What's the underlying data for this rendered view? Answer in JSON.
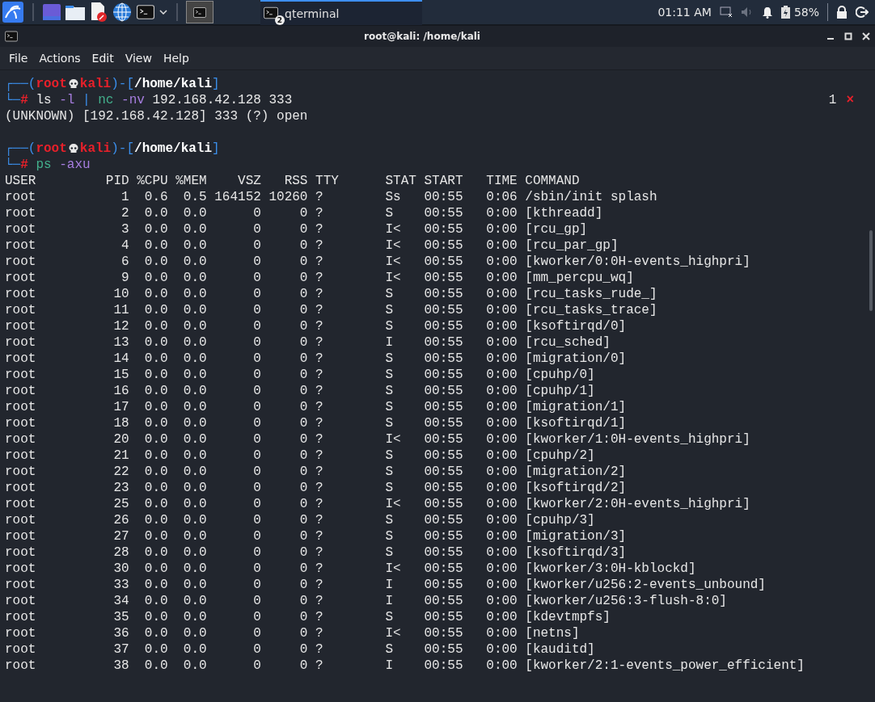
{
  "taskbar": {
    "task": {
      "label": "qterminal",
      "count": "2"
    },
    "clock": "01:11 AM",
    "battery": "58%"
  },
  "window": {
    "title": "root@kali: /home/kali"
  },
  "menu": [
    "File",
    "Actions",
    "Edit",
    "View",
    "Help"
  ],
  "terminal": {
    "blocks": [
      {
        "prompt": {
          "frame_open": "┌──(",
          "user": "root",
          "host": "kali",
          "frame_mid": ")-[",
          "path": "/home/kali",
          "frame_close": "]",
          "corner": "└─",
          "symbol": "#",
          "command": [
            {
              "text": "ls",
              "kind": "cmd"
            },
            {
              "text": " -l ",
              "kind": "opt"
            },
            {
              "text": "|",
              "kind": "pipe"
            },
            {
              "text": " nc",
              "kind": "prog"
            },
            {
              "text": " -nv",
              "kind": "opt"
            },
            {
              "text": " 192.168.42.128 333",
              "kind": "arg"
            }
          ]
        },
        "status": {
          "code": "1",
          "mark": "×"
        },
        "output": [
          "(UNKNOWN) [192.168.42.128] 333 (?) open"
        ]
      },
      {
        "prompt": {
          "frame_open": "┌──(",
          "user": "root",
          "host": "kali",
          "frame_mid": ")-[",
          "path": "/home/kali",
          "frame_close": "]",
          "corner": "└─",
          "symbol": "#",
          "command": [
            {
              "text": "ps",
              "kind": "prog"
            },
            {
              "text": " -axu",
              "kind": "opt"
            }
          ]
        },
        "output": [
          "USER         PID %CPU %MEM    VSZ   RSS TTY      STAT START   TIME COMMAND",
          "root           1  0.6  0.5 164152 10260 ?        Ss   00:55   0:06 /sbin/init splash",
          "root           2  0.0  0.0      0     0 ?        S    00:55   0:00 [kthreadd]",
          "root           3  0.0  0.0      0     0 ?        I<   00:55   0:00 [rcu_gp]",
          "root           4  0.0  0.0      0     0 ?        I<   00:55   0:00 [rcu_par_gp]",
          "root           6  0.0  0.0      0     0 ?        I<   00:55   0:00 [kworker/0:0H-events_highpri]",
          "root           9  0.0  0.0      0     0 ?        I<   00:55   0:00 [mm_percpu_wq]",
          "root          10  0.0  0.0      0     0 ?        S    00:55   0:00 [rcu_tasks_rude_]",
          "root          11  0.0  0.0      0     0 ?        S    00:55   0:00 [rcu_tasks_trace]",
          "root          12  0.0  0.0      0     0 ?        S    00:55   0:00 [ksoftirqd/0]",
          "root          13  0.0  0.0      0     0 ?        I    00:55   0:00 [rcu_sched]",
          "root          14  0.0  0.0      0     0 ?        S    00:55   0:00 [migration/0]",
          "root          15  0.0  0.0      0     0 ?        S    00:55   0:00 [cpuhp/0]",
          "root          16  0.0  0.0      0     0 ?        S    00:55   0:00 [cpuhp/1]",
          "root          17  0.0  0.0      0     0 ?        S    00:55   0:00 [migration/1]",
          "root          18  0.0  0.0      0     0 ?        S    00:55   0:00 [ksoftirqd/1]",
          "root          20  0.0  0.0      0     0 ?        I<   00:55   0:00 [kworker/1:0H-events_highpri]",
          "root          21  0.0  0.0      0     0 ?        S    00:55   0:00 [cpuhp/2]",
          "root          22  0.0  0.0      0     0 ?        S    00:55   0:00 [migration/2]",
          "root          23  0.0  0.0      0     0 ?        S    00:55   0:00 [ksoftirqd/2]",
          "root          25  0.0  0.0      0     0 ?        I<   00:55   0:00 [kworker/2:0H-events_highpri]",
          "root          26  0.0  0.0      0     0 ?        S    00:55   0:00 [cpuhp/3]",
          "root          27  0.0  0.0      0     0 ?        S    00:55   0:00 [migration/3]",
          "root          28  0.0  0.0      0     0 ?        S    00:55   0:00 [ksoftirqd/3]",
          "root          30  0.0  0.0      0     0 ?        I<   00:55   0:00 [kworker/3:0H-kblockd]",
          "root          33  0.0  0.0      0     0 ?        I    00:55   0:00 [kworker/u256:2-events_unbound]",
          "root          34  0.0  0.0      0     0 ?        I    00:55   0:00 [kworker/u256:3-flush-8:0]",
          "root          35  0.0  0.0      0     0 ?        S    00:55   0:00 [kdevtmpfs]",
          "root          36  0.0  0.0      0     0 ?        I<   00:55   0:00 [netns]",
          "root          37  0.0  0.0      0     0 ?        S    00:55   0:00 [kauditd]",
          "root          38  0.0  0.0      0     0 ?        I    00:55   0:00 [kworker/2:1-events_power_efficient]"
        ]
      }
    ]
  }
}
